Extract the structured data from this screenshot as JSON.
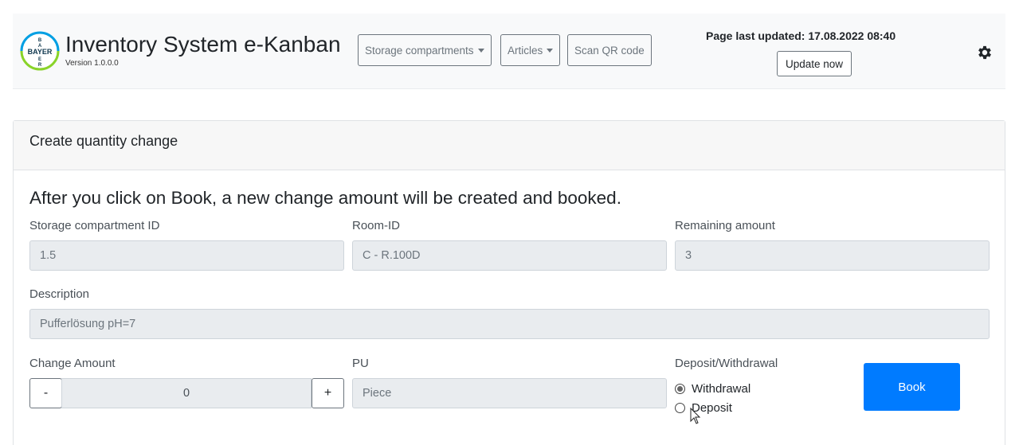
{
  "header": {
    "logo_text": "BAYER",
    "title": "Inventory System e-Kanban",
    "version": "Version 1.0.0.0",
    "nav": {
      "storage_compartments": "Storage compartments",
      "articles": "Articles",
      "scan_qr": "Scan QR code"
    },
    "last_updated": "Page last updated: 17.08.2022 08:40",
    "update_now": "Update now"
  },
  "card": {
    "header": "Create quantity change",
    "lead": "After you click on Book, a new change amount will be created and booked.",
    "fields": {
      "storage_compartment_id": {
        "label": "Storage compartment ID",
        "value": "1.5"
      },
      "room_id": {
        "label": "Room-ID",
        "value": "C - R.100D"
      },
      "remaining_amount": {
        "label": "Remaining amount",
        "value": "3"
      },
      "description": {
        "label": "Description",
        "value": "Pufferlösung pH=7"
      },
      "change_amount": {
        "label": "Change Amount",
        "value": "0",
        "decrement": "-",
        "increment": "+"
      },
      "pu": {
        "label": "PU",
        "value": "Piece"
      }
    },
    "deposit_withdrawal": {
      "label": "Deposit/Withdrawal",
      "withdrawal": "Withdrawal",
      "deposit": "Deposit",
      "selected": "Withdrawal"
    },
    "book": "Book"
  },
  "colors": {
    "primary": "#007bff",
    "navbar_bg": "#f8f9fa",
    "readonly_bg": "#e9ecef"
  },
  "icons": [
    "bayer-logo-icon",
    "caret-down-icon",
    "gear-icon",
    "mouse-cursor-icon"
  ]
}
